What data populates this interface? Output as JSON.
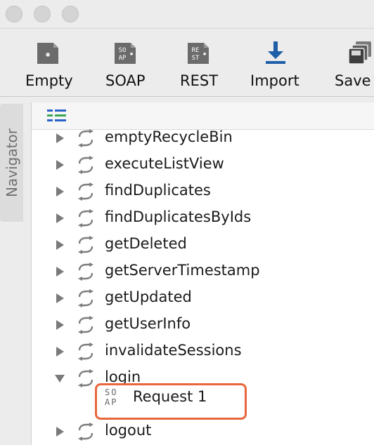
{
  "toolbar": {
    "buttons": [
      {
        "label": "Empty",
        "icon": "empty-project-icon"
      },
      {
        "label": "SOAP",
        "icon": "soap-project-icon"
      },
      {
        "label": "REST",
        "icon": "rest-project-icon"
      },
      {
        "label": "Import",
        "icon": "import-icon"
      },
      {
        "label": "Save All",
        "icon": "save-all-icon"
      }
    ]
  },
  "navigator": {
    "tab_label": "Navigator",
    "header_icon": "tree-view-icon",
    "items": [
      {
        "label": "emptyRecycleBin",
        "expanded": false
      },
      {
        "label": "executeListView",
        "expanded": false
      },
      {
        "label": "findDuplicates",
        "expanded": false
      },
      {
        "label": "findDuplicatesByIds",
        "expanded": false
      },
      {
        "label": "getDeleted",
        "expanded": false
      },
      {
        "label": "getServerTimestamp",
        "expanded": false
      },
      {
        "label": "getUpdated",
        "expanded": false
      },
      {
        "label": "getUserInfo",
        "expanded": false
      },
      {
        "label": "invalidateSessions",
        "expanded": false
      },
      {
        "label": "login",
        "expanded": true
      },
      {
        "label": "logout",
        "expanded": false
      }
    ],
    "request": {
      "label": "Request 1",
      "icon_text": [
        "SO",
        "AP"
      ],
      "highlighted": true
    }
  },
  "colors": {
    "highlight": "#e8663c",
    "import_arrow": "#1f5fa8",
    "tree_icon_green": "#3aa655",
    "tree_icon_blue": "#2a62c9"
  }
}
